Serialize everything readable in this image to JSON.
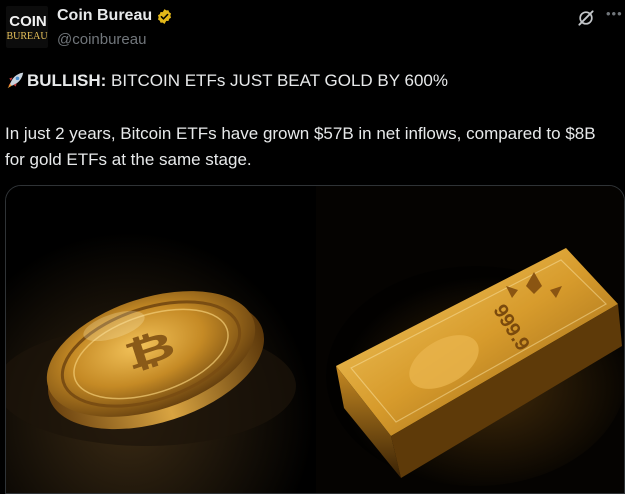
{
  "author": {
    "name": "Coin Bureau",
    "handle": "@coinbureau",
    "avatar_line1": "COIN",
    "avatar_line2": "BUREAU",
    "verified": true
  },
  "post": {
    "headline_bold": "BULLISH:",
    "headline_rest": " BITCOIN ETFs JUST BEAT GOLD BY 600%",
    "body": "In just 2 years, Bitcoin ETFs have grown $57B in net inflows, compared to $8B for gold ETFs at the same stage."
  },
  "media": {
    "left_image": "bitcoin-coin",
    "right_image": "gold-bar",
    "gold_bar_text": "999.9"
  },
  "icons": {
    "verified": "verified-badge-icon",
    "grok": "grok-icon",
    "more": "more-options-icon",
    "rocket": "rocket-emoji-icon"
  },
  "colors": {
    "background": "#000000",
    "text": "#e7e9ea",
    "secondary": "#71767b",
    "verified_gold": "#e2b719",
    "gold": "#c8922a"
  }
}
